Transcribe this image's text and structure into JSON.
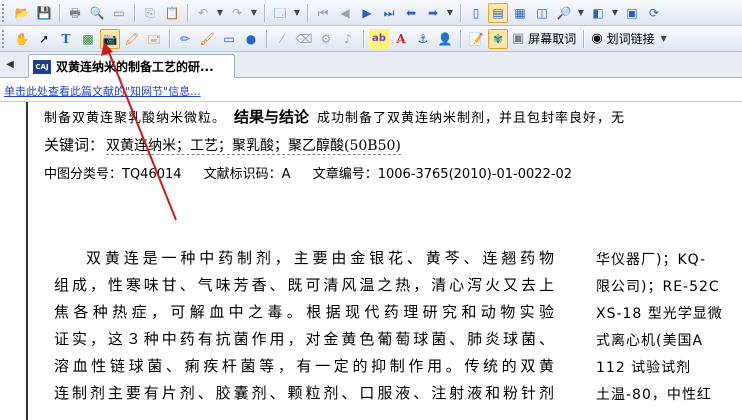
{
  "toolbar1": {
    "buttons": [
      {
        "name": "open-icon",
        "glyph": "📂"
      },
      {
        "name": "save-icon",
        "glyph": "💾"
      },
      {
        "name": "print-icon",
        "glyph": "🖶"
      },
      {
        "name": "print-preview-icon",
        "glyph": "🔍"
      },
      {
        "name": "view-icon",
        "glyph": "▭"
      },
      {
        "name": "copy-icon",
        "glyph": "⎘"
      },
      {
        "name": "paste-icon",
        "glyph": "📋"
      },
      {
        "name": "undo-icon",
        "glyph": "↶"
      },
      {
        "name": "redo-icon",
        "glyph": "↷"
      },
      {
        "name": "properties-icon",
        "glyph": "🗔"
      },
      {
        "name": "first-page-icon",
        "glyph": "⏮"
      },
      {
        "name": "prev-page-icon",
        "glyph": "◀"
      },
      {
        "name": "next-page-icon",
        "glyph": "▶"
      },
      {
        "name": "last-page-icon",
        "glyph": "⏭"
      },
      {
        "name": "back-icon",
        "glyph": "⬅"
      },
      {
        "name": "forward-icon",
        "glyph": "➡"
      },
      {
        "name": "single-page-icon",
        "glyph": "▯"
      },
      {
        "name": "fit-width-icon",
        "glyph": "▤"
      },
      {
        "name": "continuous-icon",
        "glyph": "▦"
      },
      {
        "name": "two-page-icon",
        "glyph": "◫"
      },
      {
        "name": "zoom-icon",
        "glyph": "🔎"
      },
      {
        "name": "layout-icon",
        "glyph": "◧"
      },
      {
        "name": "fullscreen-icon",
        "glyph": "▣"
      },
      {
        "name": "rotate-icon",
        "glyph": "⟳"
      }
    ]
  },
  "toolbar2": {
    "buttons": [
      {
        "name": "hand-tool-icon",
        "glyph": "✋"
      },
      {
        "name": "select-arrow-icon",
        "glyph": "➚"
      },
      {
        "name": "text-select-icon",
        "glyph": "T"
      },
      {
        "name": "image-select-icon",
        "glyph": "▩"
      },
      {
        "name": "snapshot-icon",
        "glyph": "📷"
      },
      {
        "name": "highlight-icon",
        "glyph": "🖍"
      },
      {
        "name": "stamp-icon",
        "glyph": "🖃"
      },
      {
        "name": "pencil-icon",
        "glyph": "✏"
      },
      {
        "name": "brush-icon",
        "glyph": "🖌"
      },
      {
        "name": "rectangle-icon",
        "glyph": "▭"
      },
      {
        "name": "ellipse-icon",
        "glyph": "●"
      },
      {
        "name": "line-icon",
        "glyph": "⁄"
      },
      {
        "name": "eraser-icon",
        "glyph": "⌫"
      },
      {
        "name": "gear-icon",
        "glyph": "⚙"
      },
      {
        "name": "music-icon",
        "glyph": "♪"
      },
      {
        "name": "text-highlight-icon",
        "glyph": "ab"
      },
      {
        "name": "font-color-icon",
        "glyph": "A"
      },
      {
        "name": "anchor-icon",
        "glyph": "⚓"
      },
      {
        "name": "user-icon",
        "glyph": "👤"
      },
      {
        "name": "notes-icon",
        "glyph": "📝"
      },
      {
        "name": "link-tool-icon",
        "glyph": "✾"
      }
    ],
    "screen_word_label": "屏幕取词",
    "word_link_label": "划词链接"
  },
  "tabs": {
    "active_label": "双黄连纳米的制备工艺的研..."
  },
  "link_strip": {
    "link_text": "单击此处查看此篇文献的\"知网节\"信息..."
  },
  "document": {
    "abstract_lead": "制备双黄连聚乳酸纳米微粒。",
    "abstract_head": "结果与结论",
    "abstract_tail": "成功制备了双黄连纳米制剂，并且包封率良好，无",
    "keywords_label": "关键词：",
    "keywords": "双黄连纳米；工艺；聚乳酸；聚乙醇酸(50B50)",
    "clc": "中图分类号：TQ46014",
    "doc_code": "文献标识码：A",
    "article_no": "文章编号：1006-3765(2010)-01-0022-02",
    "body_lines": [
      "双黄连是一种中药制剂，主要由金银花、黄芩、连翘药物",
      "组成，性寒味甘、气味芳香、既可清风温之热，清心泻火又去上",
      "焦各种热症，可解血中之毒。根据现代药理研究和动物实验",
      "证实，这３种中药有抗菌作用，对金黄色葡萄球菌、肺炎球菌、",
      "溶血性链球菌、痢疾杆菌等，有一定的抑制作用。传统的双黄",
      "连制剂主要有片剂、胶囊剂、颗粒剂、口服液、注射液和粉针剂"
    ],
    "right_lines": [
      "华仪器厂)；KQ-",
      "限公司)；RE-52C",
      "XS-18 型光学显微",
      "式离心机(美国A",
      "112   试验试剂",
      "土温-80，中性红"
    ]
  },
  "colors": {
    "toolbar_bg": "#dfe6f0",
    "link_blue": "#1f45c4",
    "annotation_red": "#cc1a1a"
  }
}
